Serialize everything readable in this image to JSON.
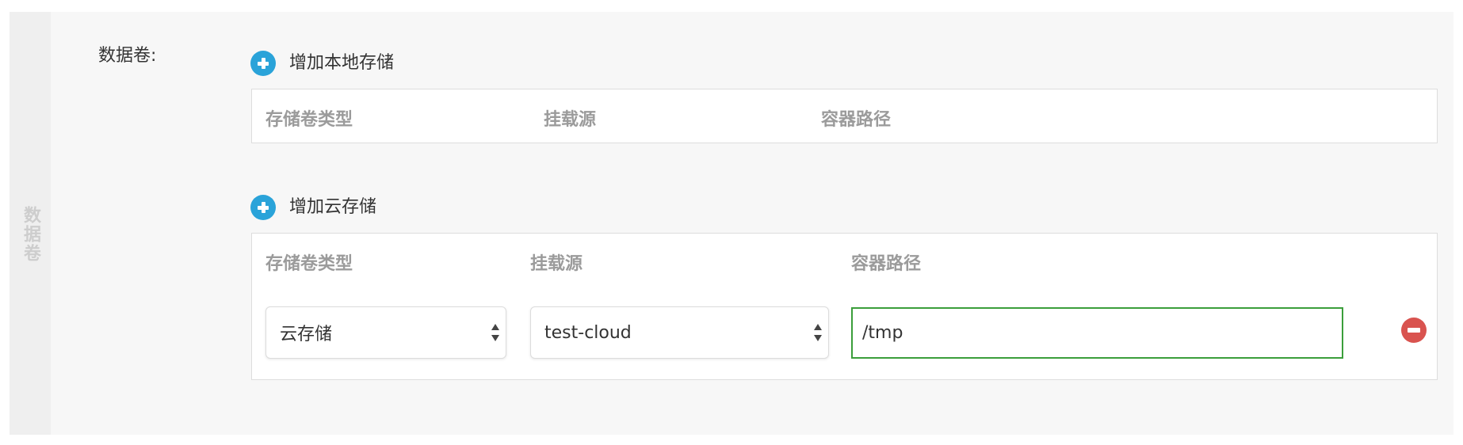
{
  "side_tab": {
    "label": "数据卷"
  },
  "field": {
    "label": "数据卷:"
  },
  "local_storage": {
    "add_label": "增加本地存储",
    "columns": [
      "存储卷类型",
      "挂载源",
      "容器路径"
    ]
  },
  "cloud_storage": {
    "add_label": "增加云存储",
    "columns": [
      "存储卷类型",
      "挂载源",
      "容器路径"
    ],
    "rows": [
      {
        "volume_type": "云存储",
        "mount_source": "test-cloud",
        "container_path": "/tmp"
      }
    ]
  },
  "colors": {
    "add_icon": "#2aa3d9",
    "remove_icon": "#d9534f",
    "active_input_border": "#3b9e3b",
    "header_text": "#9b9b9b"
  }
}
